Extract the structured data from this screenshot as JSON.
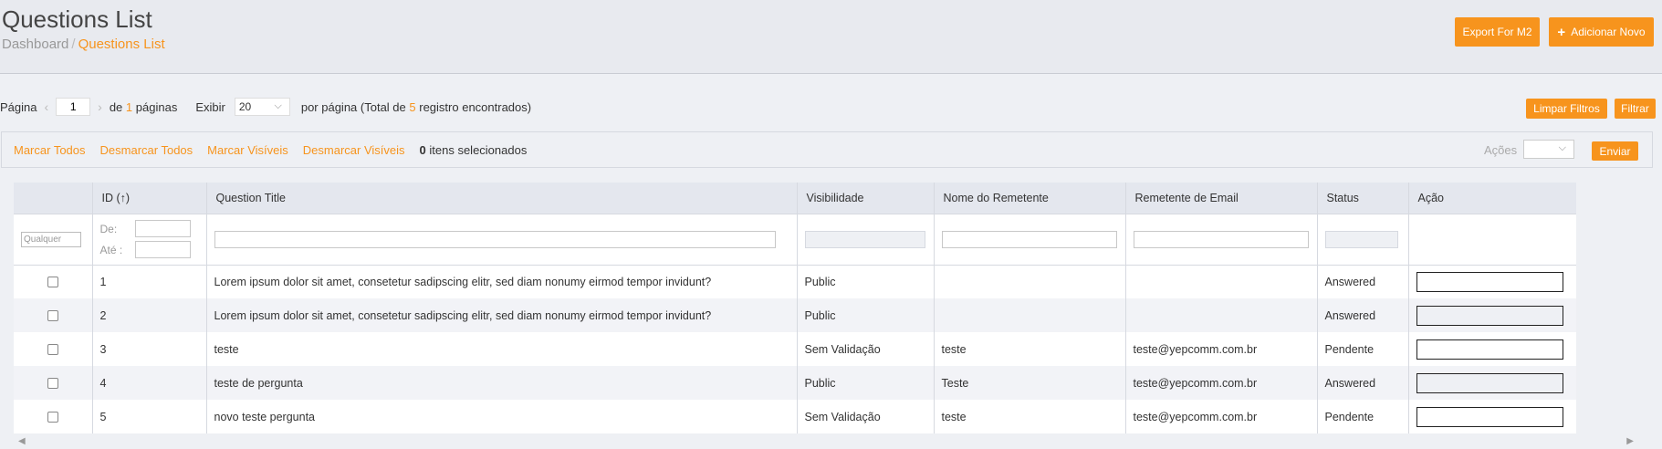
{
  "header": {
    "title": "Questions List",
    "breadcrumb": {
      "home": "Dashboard",
      "separator": "/",
      "current": "Questions List"
    },
    "export_label": "Export For M2",
    "add_label": "Adicionar Novo"
  },
  "pager": {
    "page_label": "Página",
    "page_value": "1",
    "of_prefix": "de",
    "total_pages": "1",
    "of_suffix": "páginas",
    "show_label": "Exibir",
    "per_page": "20",
    "per_page_prefix": "por página (Total de",
    "total_records": "5",
    "per_page_suffix": "registro encontrados)",
    "clear_filters_label": "Limpar Filtros",
    "filter_label": "Filtrar"
  },
  "massaction": {
    "select_all": "Marcar Todos",
    "unselect_all": "Desmarcar Todos",
    "select_visible": "Marcar Visíveis",
    "unselect_visible": "Desmarcar Visíveis",
    "selected_count": "0",
    "selected_suffix": "itens selecionados",
    "actions_label": "Ações",
    "submit_label": "Enviar"
  },
  "grid": {
    "columns": [
      "",
      "ID (↑)",
      "Question Title",
      "Visibilidade",
      "Nome do Remetente",
      "Remetente de Email",
      "Status",
      "Ação"
    ],
    "filters": {
      "any_placeholder": "Qualquer",
      "from_label": "De:",
      "to_label": "Até :"
    },
    "rows": [
      {
        "id": "1",
        "title": "Lorem ipsum dolor sit amet, consetetur sadipscing elitr, sed diam nonumy eirmod tempor invidunt?",
        "visibility": "Public",
        "sender": "",
        "email": "",
        "status": "Answered"
      },
      {
        "id": "2",
        "title": "Lorem ipsum dolor sit amet, consetetur sadipscing elitr, sed diam nonumy eirmod tempor invidunt?",
        "visibility": "Public",
        "sender": "",
        "email": "",
        "status": "Answered"
      },
      {
        "id": "3",
        "title": "teste",
        "visibility": "Sem Validação",
        "sender": "teste",
        "email": "teste@yepcomm.com.br",
        "status": "Pendente"
      },
      {
        "id": "4",
        "title": "teste de pergunta",
        "visibility": "Public",
        "sender": "Teste",
        "email": "teste@yepcomm.com.br",
        "status": "Answered"
      },
      {
        "id": "5",
        "title": "novo teste pergunta",
        "visibility": "Sem Validação",
        "sender": "teste",
        "email": "teste@yepcomm.com.br",
        "status": "Pendente"
      }
    ]
  },
  "icons": {
    "add": "plus-icon",
    "prev": "chevron-left-icon",
    "next": "chevron-right-icon",
    "dropdown": "chevron-down-icon"
  },
  "colors": {
    "accent": "#f7941d",
    "header_bg": "#e8eaef",
    "table_header_bg": "#e4e7ee"
  }
}
